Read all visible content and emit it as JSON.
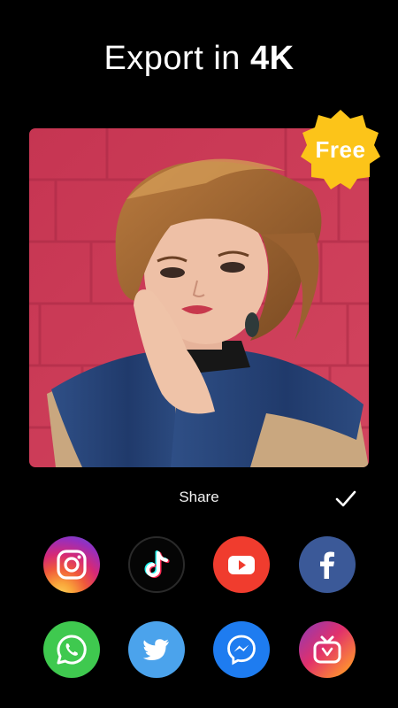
{
  "header": {
    "title_prefix": "Export in ",
    "title_emphasis": "4K"
  },
  "preview": {
    "badge": "Free"
  },
  "share": {
    "label": "Share",
    "confirm_icon": "checkmark-icon",
    "targets": [
      {
        "name": "instagram",
        "icon": "instagram-icon",
        "color": "#d62976"
      },
      {
        "name": "tiktok",
        "icon": "tiktok-icon",
        "color": "#050505"
      },
      {
        "name": "youtube",
        "icon": "youtube-icon",
        "color": "#f03c2e"
      },
      {
        "name": "facebook",
        "icon": "facebook-icon",
        "color": "#3b5998"
      },
      {
        "name": "whatsapp",
        "icon": "whatsapp-icon",
        "color": "#3fc94f"
      },
      {
        "name": "twitter",
        "icon": "twitter-icon",
        "color": "#4ba3ec"
      },
      {
        "name": "messenger",
        "icon": "messenger-icon",
        "color": "#1e7cf0"
      },
      {
        "name": "igtv",
        "icon": "igtv-icon",
        "color": "#e1306c"
      }
    ]
  },
  "colors": {
    "background": "#000000",
    "badge": "#fcc419",
    "wall": "#c93a55"
  }
}
